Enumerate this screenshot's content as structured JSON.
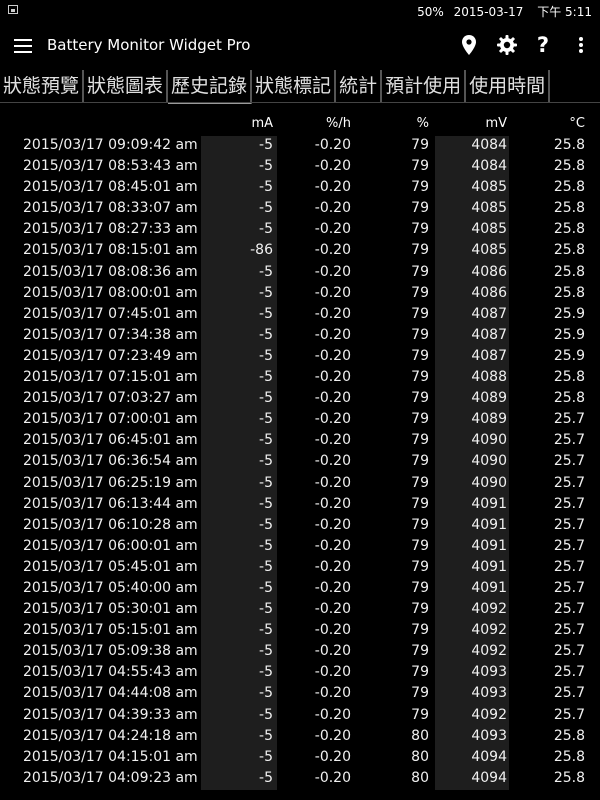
{
  "status_bar": {
    "battery": "50%",
    "date": "2015-03-17",
    "time": "下午 5:11"
  },
  "app_bar": {
    "title": "Battery Monitor Widget Pro",
    "icons": [
      "menu-icon",
      "location-pin-icon",
      "gear-icon",
      "help-icon",
      "overflow-menu-icon"
    ]
  },
  "tabs": [
    {
      "label": "狀態預覽"
    },
    {
      "label": "狀態圖表"
    },
    {
      "label": "歷史記錄",
      "active": true
    },
    {
      "label": "狀態標記"
    },
    {
      "label": "統計"
    },
    {
      "label": "預計使用"
    },
    {
      "label": "使用時間"
    }
  ],
  "table": {
    "headers": {
      "ma": "mA",
      "pct_h": "%/h",
      "pct": "%",
      "mv": "mV",
      "temp": "°C"
    },
    "rows": [
      [
        "2015/03/17 09:09:42 am",
        "-5",
        "-0.20",
        "79",
        "4084",
        "25.8"
      ],
      [
        "2015/03/17 08:53:43 am",
        "-5",
        "-0.20",
        "79",
        "4084",
        "25.8"
      ],
      [
        "2015/03/17 08:45:01 am",
        "-5",
        "-0.20",
        "79",
        "4085",
        "25.8"
      ],
      [
        "2015/03/17 08:33:07 am",
        "-5",
        "-0.20",
        "79",
        "4085",
        "25.8"
      ],
      [
        "2015/03/17 08:27:33 am",
        "-5",
        "-0.20",
        "79",
        "4085",
        "25.8"
      ],
      [
        "2015/03/17 08:15:01 am",
        "-86",
        "-0.20",
        "79",
        "4085",
        "25.8"
      ],
      [
        "2015/03/17 08:08:36 am",
        "-5",
        "-0.20",
        "79",
        "4086",
        "25.8"
      ],
      [
        "2015/03/17 08:00:01 am",
        "-5",
        "-0.20",
        "79",
        "4086",
        "25.8"
      ],
      [
        "2015/03/17 07:45:01 am",
        "-5",
        "-0.20",
        "79",
        "4087",
        "25.9"
      ],
      [
        "2015/03/17 07:34:38 am",
        "-5",
        "-0.20",
        "79",
        "4087",
        "25.9"
      ],
      [
        "2015/03/17 07:23:49 am",
        "-5",
        "-0.20",
        "79",
        "4087",
        "25.9"
      ],
      [
        "2015/03/17 07:15:01 am",
        "-5",
        "-0.20",
        "79",
        "4088",
        "25.8"
      ],
      [
        "2015/03/17 07:03:27 am",
        "-5",
        "-0.20",
        "79",
        "4089",
        "25.8"
      ],
      [
        "2015/03/17 07:00:01 am",
        "-5",
        "-0.20",
        "79",
        "4089",
        "25.7"
      ],
      [
        "2015/03/17 06:45:01 am",
        "-5",
        "-0.20",
        "79",
        "4090",
        "25.7"
      ],
      [
        "2015/03/17 06:36:54 am",
        "-5",
        "-0.20",
        "79",
        "4090",
        "25.7"
      ],
      [
        "2015/03/17 06:25:19 am",
        "-5",
        "-0.20",
        "79",
        "4090",
        "25.7"
      ],
      [
        "2015/03/17 06:13:44 am",
        "-5",
        "-0.20",
        "79",
        "4091",
        "25.7"
      ],
      [
        "2015/03/17 06:10:28 am",
        "-5",
        "-0.20",
        "79",
        "4091",
        "25.7"
      ],
      [
        "2015/03/17 06:00:01 am",
        "-5",
        "-0.20",
        "79",
        "4091",
        "25.7"
      ],
      [
        "2015/03/17 05:45:01 am",
        "-5",
        "-0.20",
        "79",
        "4091",
        "25.7"
      ],
      [
        "2015/03/17 05:40:00 am",
        "-5",
        "-0.20",
        "79",
        "4091",
        "25.7"
      ],
      [
        "2015/03/17 05:30:01 am",
        "-5",
        "-0.20",
        "79",
        "4092",
        "25.7"
      ],
      [
        "2015/03/17 05:15:01 am",
        "-5",
        "-0.20",
        "79",
        "4092",
        "25.7"
      ],
      [
        "2015/03/17 05:09:38 am",
        "-5",
        "-0.20",
        "79",
        "4092",
        "25.7"
      ],
      [
        "2015/03/17 04:55:43 am",
        "-5",
        "-0.20",
        "79",
        "4093",
        "25.7"
      ],
      [
        "2015/03/17 04:44:08 am",
        "-5",
        "-0.20",
        "79",
        "4093",
        "25.7"
      ],
      [
        "2015/03/17 04:39:33 am",
        "-5",
        "-0.20",
        "79",
        "4092",
        "25.7"
      ],
      [
        "2015/03/17 04:24:18 am",
        "-5",
        "-0.20",
        "80",
        "4093",
        "25.8"
      ],
      [
        "2015/03/17 04:15:01 am",
        "-5",
        "-0.20",
        "80",
        "4094",
        "25.8"
      ],
      [
        "2015/03/17 04:09:23 am",
        "-5",
        "-0.20",
        "80",
        "4094",
        "25.8"
      ]
    ]
  }
}
